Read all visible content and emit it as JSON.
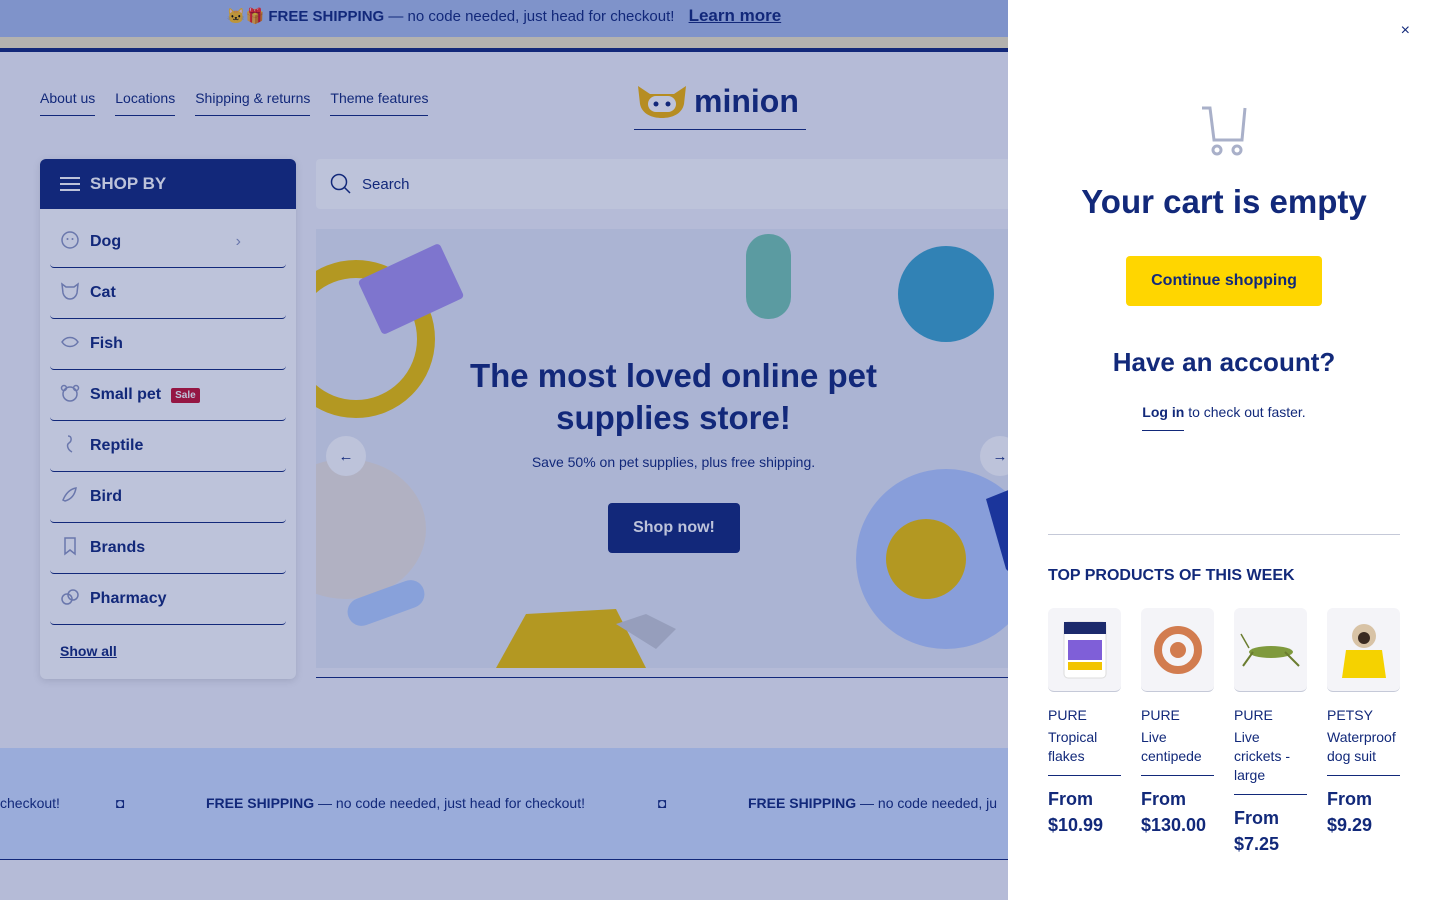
{
  "announcement": {
    "emoji": "🐱🎁",
    "bold": "FREE SHIPPING",
    "text": "— no code needed, just head for checkout!",
    "link": "Learn more"
  },
  "nav": [
    "About us",
    "Locations",
    "Shipping & returns",
    "Theme features"
  ],
  "logo": "minion",
  "sidebar": {
    "title": "SHOP BY",
    "items": [
      {
        "label": "Dog",
        "icon": "dog-icon"
      },
      {
        "label": "Cat",
        "icon": "cat-icon"
      },
      {
        "label": "Fish",
        "icon": "fish-icon"
      },
      {
        "label": "Small pet",
        "icon": "hamster-icon",
        "badge": "Sale"
      },
      {
        "label": "Reptile",
        "icon": "reptile-icon"
      },
      {
        "label": "Bird",
        "icon": "bird-icon"
      },
      {
        "label": "Brands",
        "icon": "bookmark-icon"
      },
      {
        "label": "Pharmacy",
        "icon": "pills-icon"
      }
    ],
    "show_all": "Show all"
  },
  "search": {
    "placeholder": "Search"
  },
  "hero": {
    "title": "The most loved online pet supplies store!",
    "subtitle": "Save 50% on pet supplies, plus free shipping.",
    "cta": "Shop now!"
  },
  "marquee": {
    "fragment": "checkout!",
    "bold": "FREE SHIPPING",
    "text": "— no code needed, just head for checkout!",
    "text_short": "— no code needed, ju"
  },
  "cart": {
    "close": "×",
    "empty_title": "Your cart is empty",
    "continue": "Continue shopping",
    "account_title": "Have an account?",
    "login_link": "Log in",
    "login_text": "to check out faster.",
    "top_title": "TOP PRODUCTS OF THIS WEEK",
    "products": [
      {
        "vendor": "PURE",
        "name": "Tropical flakes",
        "price": "From $10.99"
      },
      {
        "vendor": "PURE",
        "name": "Live centipede",
        "price": "From $130.00"
      },
      {
        "vendor": "PURE",
        "name": "Live crickets - large",
        "price": "From $7.25"
      },
      {
        "vendor": "PETSY",
        "name": "Waterproof dog suit",
        "price": "From $9.29"
      }
    ]
  },
  "colors": {
    "navy": "#12297a",
    "yellow": "#ffd600",
    "sale_red": "#c8102e"
  }
}
